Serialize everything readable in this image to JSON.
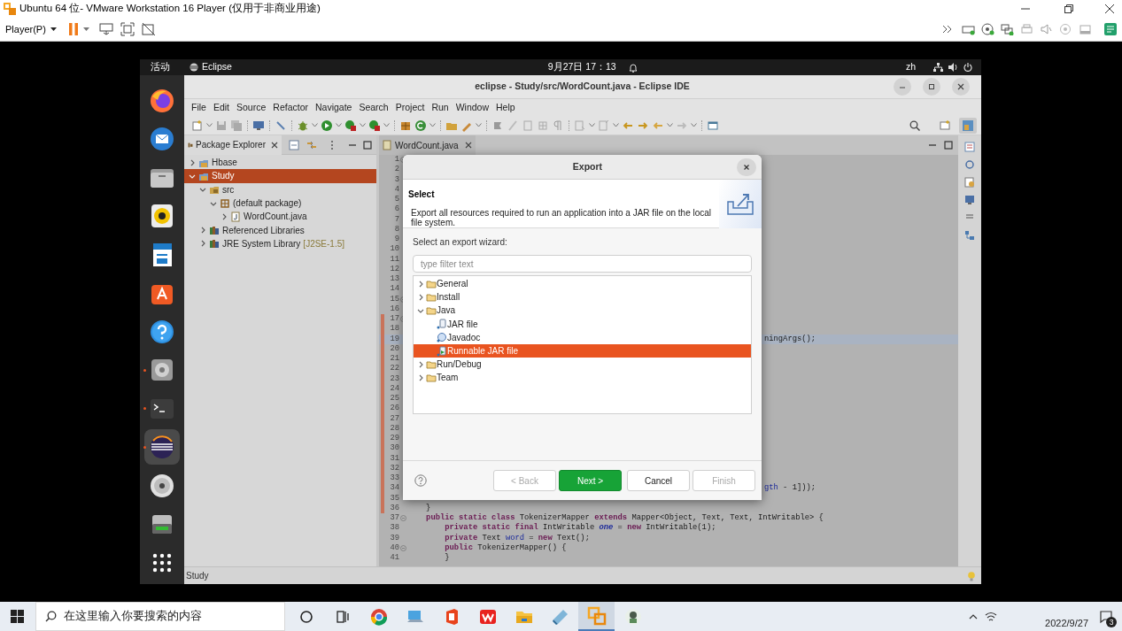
{
  "vmware": {
    "title": "Ubuntu 64 位- VMware Workstation 16 Player (仅用于非商业用途)",
    "player_menu": "Player(P)"
  },
  "ubuntu_topbar": {
    "activities": "活动",
    "app_name": "Eclipse",
    "clock": "9月27日 17：13",
    "input_method": "zh"
  },
  "dock": [
    {
      "kind": "browser",
      "running": false,
      "selected": false
    },
    {
      "kind": "mail",
      "running": false,
      "selected": false
    },
    {
      "kind": "folder",
      "running": false,
      "selected": false
    },
    {
      "kind": "speaker",
      "running": false,
      "selected": false
    },
    {
      "kind": "document",
      "running": false,
      "selected": false
    },
    {
      "kind": "store",
      "running": false,
      "selected": false
    },
    {
      "kind": "help",
      "running": false,
      "selected": false
    },
    {
      "kind": "disk",
      "running": true,
      "selected": false
    },
    {
      "kind": "terminal",
      "running": true,
      "selected": false
    },
    {
      "kind": "eclipse",
      "running": true,
      "selected": true
    },
    {
      "kind": "disc",
      "running": false,
      "selected": false
    },
    {
      "kind": "drive",
      "running": false,
      "selected": false
    },
    {
      "kind": "apps",
      "running": false,
      "selected": false
    }
  ],
  "eclipse": {
    "title": "eclipse - Study/src/WordCount.java - Eclipse IDE",
    "menu": [
      "File",
      "Edit",
      "Source",
      "Refactor",
      "Navigate",
      "Search",
      "Project",
      "Run",
      "Window",
      "Help"
    ],
    "package_explorer": {
      "tab": "Package Explorer",
      "tree": [
        {
          "label": "Hbase",
          "kind": "project",
          "expanded": false,
          "selected": false
        },
        {
          "label": "Study",
          "kind": "project",
          "expanded": true,
          "selected": true,
          "children": [
            {
              "label": "src",
              "kind": "source-folder",
              "expanded": true,
              "selected": false,
              "children": [
                {
                  "label": "(default package)",
                  "kind": "package",
                  "expanded": true,
                  "selected": false,
                  "children": [
                    {
                      "label": "WordCount.java",
                      "kind": "java-file",
                      "expanded": false,
                      "selected": false
                    }
                  ]
                }
              ]
            },
            {
              "label": "Referenced Libraries",
              "kind": "library",
              "expanded": false,
              "selected": false
            },
            {
              "label": "JRE System Library",
              "decoration": "[J2SE-1.5]",
              "kind": "library",
              "expanded": false,
              "selected": false
            }
          ]
        }
      ]
    },
    "editor": {
      "tab": "WordCount.java",
      "lines": [
        {
          "n": "1",
          "fold": true,
          "changed": false,
          "current": false
        },
        {
          "n": "2",
          "fold": false,
          "changed": false,
          "current": false
        },
        {
          "n": "3",
          "fold": false,
          "changed": false,
          "current": false
        },
        {
          "n": "4",
          "fold": false,
          "changed": false,
          "current": false
        },
        {
          "n": "5",
          "fold": false,
          "changed": false,
          "current": false
        },
        {
          "n": "6",
          "fold": false,
          "changed": false,
          "current": false
        },
        {
          "n": "7",
          "fold": false,
          "changed": false,
          "current": false
        },
        {
          "n": "8",
          "fold": false,
          "changed": false,
          "current": false
        },
        {
          "n": "9",
          "fold": false,
          "changed": false,
          "current": false
        },
        {
          "n": "10",
          "fold": false,
          "changed": false,
          "current": false
        },
        {
          "n": "11",
          "fold": false,
          "changed": false,
          "current": false
        },
        {
          "n": "12",
          "fold": false,
          "changed": false,
          "current": false
        },
        {
          "n": "13",
          "fold": false,
          "changed": false,
          "current": false
        },
        {
          "n": "14",
          "fold": false,
          "changed": false,
          "current": false
        },
        {
          "n": "15",
          "fold": true,
          "changed": false,
          "current": false
        },
        {
          "n": "16",
          "fold": false,
          "changed": false,
          "current": false
        },
        {
          "n": "17",
          "fold": true,
          "changed": true,
          "current": false
        },
        {
          "n": "18",
          "fold": false,
          "changed": true,
          "current": false
        },
        {
          "n": "19",
          "fold": false,
          "changed": true,
          "current": true,
          "clipped": true,
          "segments": [
            {
              "text": "ningArgs();",
              "kind": "plain"
            }
          ]
        },
        {
          "n": "20",
          "fold": false,
          "changed": true,
          "current": false
        },
        {
          "n": "21",
          "fold": false,
          "changed": true,
          "current": false
        },
        {
          "n": "22",
          "fold": false,
          "changed": true,
          "current": false
        },
        {
          "n": "23",
          "fold": false,
          "changed": true,
          "current": false
        },
        {
          "n": "24",
          "fold": false,
          "changed": true,
          "current": false
        },
        {
          "n": "25",
          "fold": false,
          "changed": true,
          "current": false
        },
        {
          "n": "26",
          "fold": false,
          "changed": true,
          "current": false
        },
        {
          "n": "27",
          "fold": false,
          "changed": true,
          "current": false
        },
        {
          "n": "28",
          "fold": false,
          "changed": true,
          "current": false
        },
        {
          "n": "29",
          "fold": false,
          "changed": true,
          "current": false
        },
        {
          "n": "30",
          "fold": false,
          "changed": true,
          "current": false
        },
        {
          "n": "31",
          "fold": false,
          "changed": true,
          "current": false
        },
        {
          "n": "32",
          "fold": false,
          "changed": true,
          "current": false
        },
        {
          "n": "33",
          "fold": false,
          "changed": true,
          "current": false
        },
        {
          "n": "34",
          "fold": false,
          "changed": true,
          "current": false,
          "clipped": true,
          "segments": [
            {
              "text": "gth",
              "kind": "field"
            },
            {
              "text": " - 1]));",
              "kind": "plain"
            }
          ]
        },
        {
          "n": "35",
          "fold": false,
          "changed": true,
          "current": false
        },
        {
          "n": "36",
          "fold": false,
          "changed": true,
          "current": false,
          "segments": [
            {
              "text": "    }",
              "kind": "plain"
            }
          ]
        },
        {
          "n": "37",
          "fold": true,
          "changed": false,
          "current": false,
          "segments": [
            {
              "text": "    public static class",
              "kind": "keyword"
            },
            {
              "text": " TokenizerMapper ",
              "kind": "plain"
            },
            {
              "text": "extends",
              "kind": "keyword"
            },
            {
              "text": " Mapper<Object, Text, Text, IntWritable> {",
              "kind": "plain"
            }
          ]
        },
        {
          "n": "38",
          "fold": false,
          "changed": false,
          "current": false,
          "segments": [
            {
              "text": "        private static final",
              "kind": "keyword"
            },
            {
              "text": " IntWritable ",
              "kind": "plain"
            },
            {
              "text": "one",
              "kind": "static"
            },
            {
              "text": " = ",
              "kind": "plain"
            },
            {
              "text": "new",
              "kind": "keyword"
            },
            {
              "text": " IntWritable(1);",
              "kind": "plain"
            }
          ]
        },
        {
          "n": "39",
          "fold": false,
          "changed": false,
          "current": false,
          "segments": [
            {
              "text": "        private",
              "kind": "keyword"
            },
            {
              "text": " Text ",
              "kind": "plain"
            },
            {
              "text": "word",
              "kind": "field"
            },
            {
              "text": " = ",
              "kind": "plain"
            },
            {
              "text": "new",
              "kind": "keyword"
            },
            {
              "text": " Text();",
              "kind": "plain"
            }
          ]
        },
        {
          "n": "40",
          "fold": true,
          "changed": false,
          "current": false,
          "segments": [
            {
              "text": "        public",
              "kind": "keyword"
            },
            {
              "text": " TokenizerMapper() {",
              "kind": "plain"
            }
          ]
        },
        {
          "n": "41",
          "fold": false,
          "changed": false,
          "current": false,
          "segments": [
            {
              "text": "        }",
              "kind": "plain"
            }
          ]
        }
      ]
    },
    "status_bar": "Study"
  },
  "dialog": {
    "title": "Export",
    "heading": "Select",
    "description": "Export all resources required to run an application into a JAR file on the local file system.",
    "wizard_label": "Select an export wizard:",
    "filter": {
      "placeholder": "type filter text"
    },
    "tree": [
      {
        "label": "General",
        "kind": "folder",
        "expanded": false,
        "selected": false
      },
      {
        "label": "Install",
        "kind": "folder",
        "expanded": false,
        "selected": false
      },
      {
        "label": "Java",
        "kind": "folder",
        "expanded": true,
        "selected": false,
        "children": [
          {
            "label": "JAR file",
            "kind": "jar",
            "selected": false
          },
          {
            "label": "Javadoc",
            "kind": "javadoc",
            "selected": false
          },
          {
            "label": "Runnable JAR file",
            "kind": "runnable-jar",
            "selected": true
          }
        ]
      },
      {
        "label": "Run/Debug",
        "kind": "folder",
        "expanded": false,
        "selected": false
      },
      {
        "label": "Team",
        "kind": "folder",
        "expanded": false,
        "selected": false
      }
    ],
    "buttons": [
      {
        "label": "< Back",
        "kind": "secondary",
        "disabled": true
      },
      {
        "label": "Next >",
        "kind": "primary",
        "disabled": false
      },
      {
        "label": "Cancel",
        "kind": "secondary",
        "disabled": false
      },
      {
        "label": "Finish",
        "kind": "secondary",
        "disabled": true
      }
    ]
  },
  "taskbar": {
    "search_placeholder": "在这里输入你要搜索的内容",
    "apps": [
      {
        "kind": "ring",
        "selected": false
      },
      {
        "kind": "task-view",
        "selected": false
      },
      {
        "kind": "browser",
        "selected": false
      },
      {
        "kind": "computer",
        "selected": false
      },
      {
        "kind": "office",
        "selected": false
      },
      {
        "kind": "wps",
        "selected": false
      },
      {
        "kind": "folder",
        "selected": false
      },
      {
        "kind": "notebook",
        "selected": false
      },
      {
        "kind": "vmware",
        "selected": true
      },
      {
        "kind": "sprite",
        "selected": false
      }
    ],
    "date": "2022/9/27",
    "notification_count": "3"
  }
}
